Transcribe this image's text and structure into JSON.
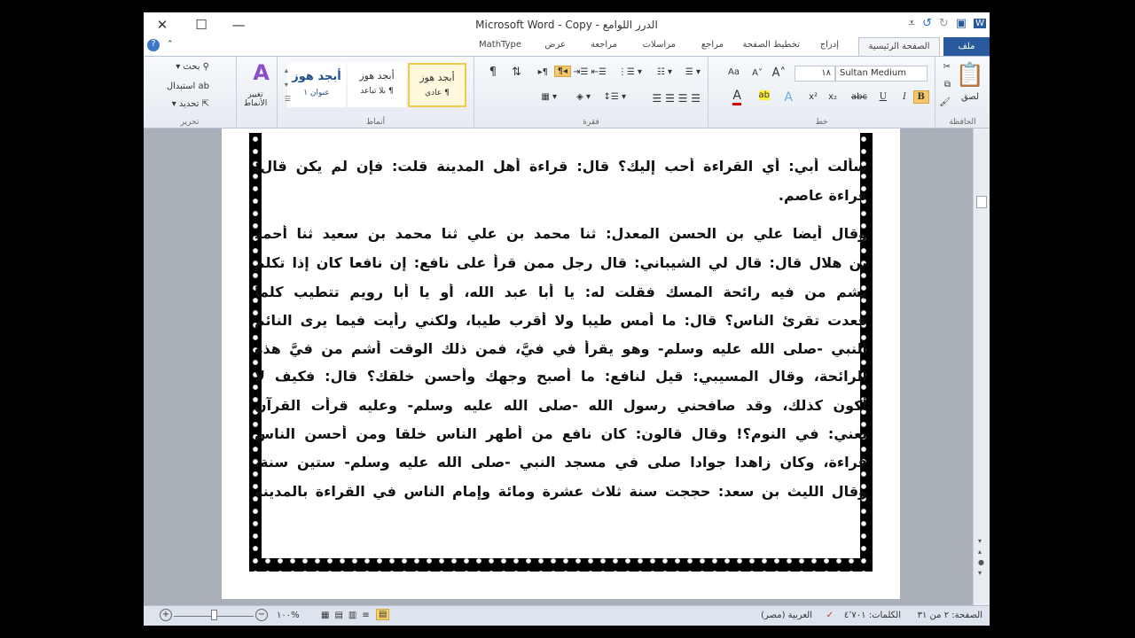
{
  "window": {
    "title": "Microsoft Word - Copy - الدرر اللوامع",
    "close": "✕",
    "maximize": "☐",
    "minimize": "—"
  },
  "tabs": [
    "ملف",
    "الصفحة الرئيسية",
    "إدراج",
    "تخطيط الصفحة",
    "مراجع",
    "مراسلات",
    "مراجعة",
    "عرض",
    "MathType"
  ],
  "ribbon": {
    "clipboard": {
      "label": "الحافظة",
      "paste": "لصق"
    },
    "font": {
      "label": "خط",
      "name": "Sultan Medium",
      "size": "١٨",
      "bold": "B",
      "italic": "I",
      "underline": "U"
    },
    "paragraph": {
      "label": "فقرة"
    },
    "styles": {
      "label": "أنماط",
      "items": [
        {
          "sample": "أبجد هوز",
          "name": "¶ عادي"
        },
        {
          "sample": "أبجد هوز",
          "name": "¶ بلا تباعد"
        },
        {
          "sample": "أبجد هوز",
          "name": "عنوان ١"
        }
      ],
      "change": "تغيير الأنماط"
    },
    "editing": {
      "label": "تحرير",
      "find": "بحث",
      "replace": "استبدال",
      "select": "تحديد"
    }
  },
  "document": {
    "lines": [
      "سألت أبي: أي القراءة أحب إليك؟ قال: قراءة أهل المدينة قلت: فإن لم يكن قال:",
      "قراءة عاصم.",
      "وقال أيضا علي بن الحسن المعدل: ثنا محمد بن علي ثنا محمد بن سعيد ثنا أحمد",
      "بن هلال قال: قال لي الشيباني: قال رجل ممن قرأ على نافع: إن نافعا كان إذا تكلم",
      "يشم من فيه رائحة المسك فقلت له: يا أبا عبد الله، أو يا أبا رويم تتطيب كلما",
      "قعدت تقرئ الناس؟ قال: ما أمس طيبا ولا أقرب طيبا، ولكني رأيت فيما يرى النائم",
      "النبي -صلى الله عليه وسلم- وهو يقرأ في فيَّ، فمن ذلك الوقت أشم من فيَّ هذه",
      "الرائحة، وقال المسيبي: قيل لنافع: ما أصبح وجهك وأحسن خلقك؟ قال: فكيف لا",
      "أكون كذلك، وقد صافحني رسول الله -صلى الله عليه وسلم- وعليه قرأت القرآن",
      "يعني: في النوم؟! وقال قالون: كان نافع من أطهر الناس خلقا ومن أحسن الناس",
      "قراءة، وكان زاهدا جوادا صلى في مسجد النبي -صلى الله عليه وسلم- ستين سنة،",
      "وقال الليث بن سعد: حججت سنة ثلاث عشرة ومائة وإمام الناس في القراءة بالمدينة"
    ]
  },
  "status": {
    "page": "الصفحة: ٢ من ٣١",
    "words": "الكلمات: ٤٬٧٠١",
    "language": "العربية (مصر)",
    "zoom": "%١٠٠"
  }
}
